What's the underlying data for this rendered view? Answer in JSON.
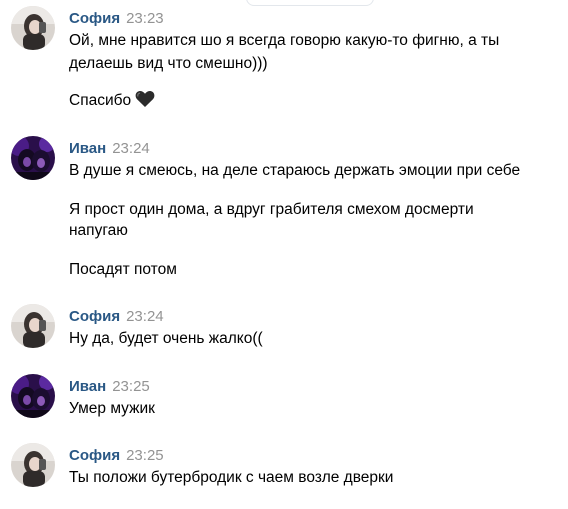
{
  "messages": [
    {
      "author": "София",
      "time": "23:23",
      "avatar": "avatar-sofia",
      "lines": [
        "Ой, мне нравится шо я всегда говорю какую-то фигню, а ты",
        "делаешь вид что смешно)))",
        "Спасибо"
      ],
      "emoji": "black-heart-icon"
    },
    {
      "author": "Иван",
      "time": "23:24",
      "avatar": "avatar-ivan",
      "lines": [
        "В душе я смеюсь, на деле стараюсь держать эмоции при себе",
        "Я прост один дома, а вдруг грабителя смехом досмерти",
        "напугаю",
        "Посадят потом"
      ]
    },
    {
      "author": "София",
      "time": "23:24",
      "avatar": "avatar-sofia",
      "lines": [
        "Ну да, будет очень жалко(("
      ]
    },
    {
      "author": "Иван",
      "time": "23:25",
      "avatar": "avatar-ivan",
      "lines": [
        "Умер мужик"
      ]
    },
    {
      "author": "София",
      "time": "23:25",
      "avatar": "avatar-sofia",
      "lines": [
        "Ты положи бутербродик с чаем возле дверки"
      ]
    }
  ],
  "colors": {
    "author": "#2a5885",
    "time": "#939393",
    "text": "#000000"
  }
}
